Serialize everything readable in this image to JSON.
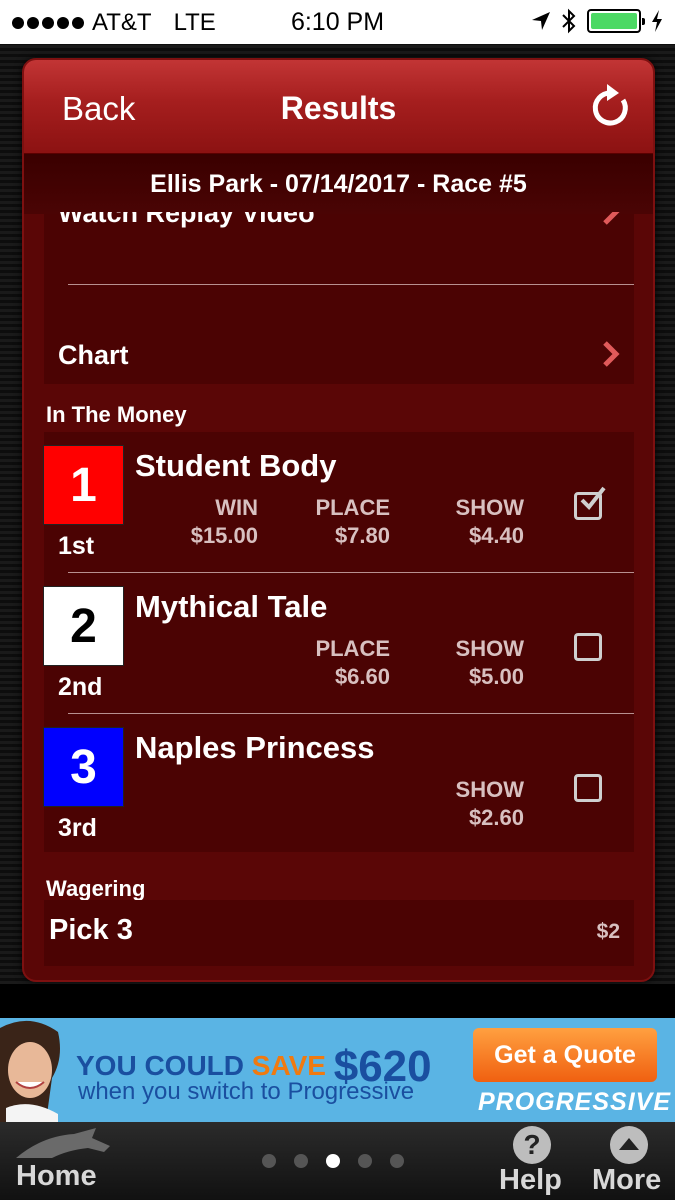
{
  "status_bar": {
    "carrier": "AT&T",
    "network": "LTE",
    "time": "6:10 PM"
  },
  "header": {
    "back_label": "Back",
    "title": "Results",
    "race_info": "Ellis Park - 07/14/2017 - Race #5"
  },
  "menu": {
    "items": [
      {
        "label": "Watch Replay Video"
      },
      {
        "label": "Chart"
      }
    ]
  },
  "in_the_money": {
    "label": "In The Money",
    "entries": [
      {
        "program_number": "1",
        "finish": "1st",
        "horse": "Student Body",
        "color": "#ff0000",
        "number_color": "#ffffff",
        "win_label": "WIN",
        "win": "$15.00",
        "place_label": "PLACE",
        "place": "$7.80",
        "show_label": "SHOW",
        "show": "$4.40",
        "checked": true
      },
      {
        "program_number": "2",
        "finish": "2nd",
        "horse": "Mythical Tale",
        "color": "#ffffff",
        "number_color": "#000000",
        "place_label": "PLACE",
        "place": "$6.60",
        "show_label": "SHOW",
        "show": "$5.00",
        "checked": false
      },
      {
        "program_number": "3",
        "finish": "3rd",
        "horse": "Naples Princess",
        "color": "#0000ff",
        "number_color": "#ffffff",
        "show_label": "SHOW",
        "show": "$2.60",
        "checked": false
      }
    ]
  },
  "wagering": {
    "label": "Wagering",
    "bet_type": "Pick 3",
    "amount": "$2"
  },
  "ad": {
    "line1_prefix": "YOU COULD",
    "line1_save": "SAVE",
    "line1_amount": "$620",
    "line2": "when you switch to Progressive",
    "cta": "Get a Quote",
    "brand": "PROGRESSIVE"
  },
  "tabbar": {
    "home": "Home",
    "help_icon": "?",
    "help": "Help",
    "more": "More",
    "page_dots": 5,
    "active_dot": 3
  },
  "colors": {
    "header_red": "#a51e1e",
    "card_maroon": "#5a0606",
    "chevron": "#e05a5a"
  }
}
